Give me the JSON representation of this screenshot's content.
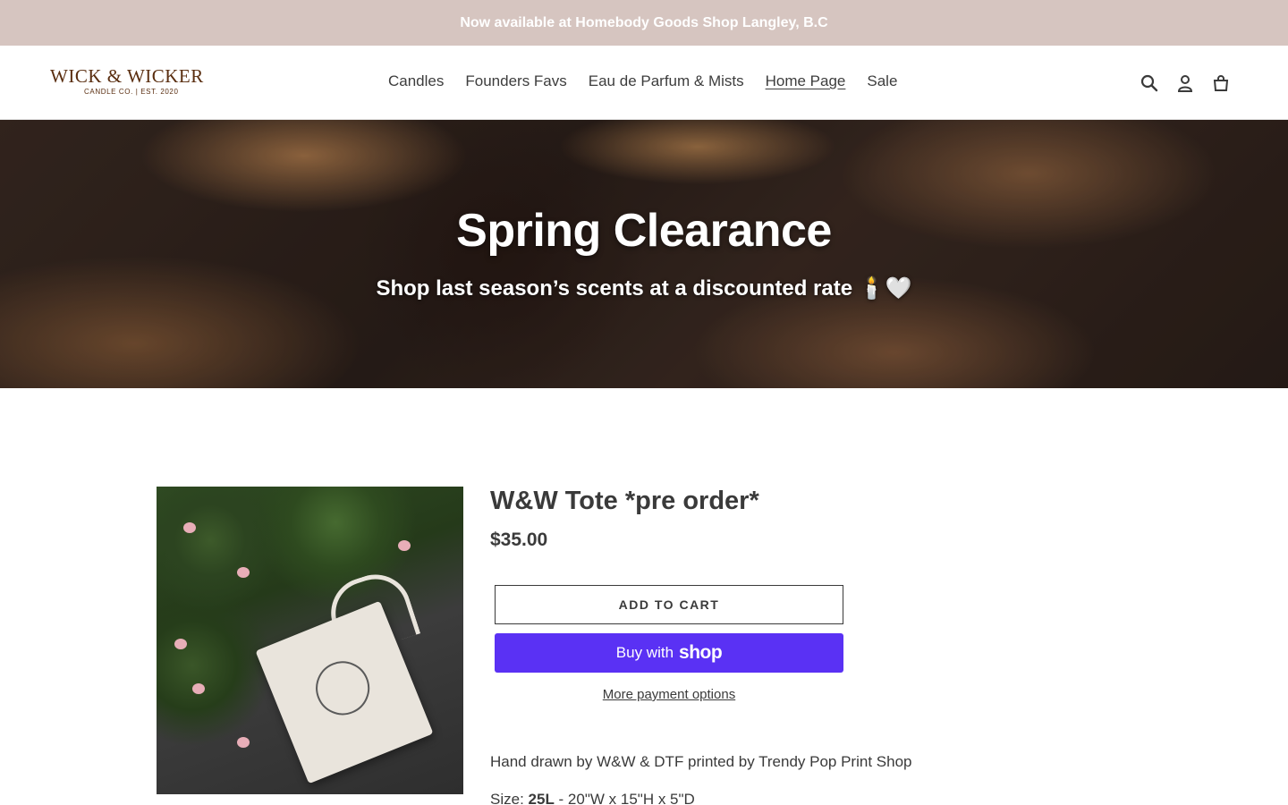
{
  "announcement": {
    "text": "Now available at Homebody Goods Shop Langley, B.C"
  },
  "header": {
    "logo": {
      "main": "WICK & WICKER",
      "sub": "CANDLE CO. | EST. 2020"
    },
    "nav": [
      {
        "label": "Candles"
      },
      {
        "label": "Founders Favs"
      },
      {
        "label": "Eau de Parfum & Mists"
      },
      {
        "label": "Home Page"
      },
      {
        "label": "Sale"
      }
    ],
    "icons": [
      "search-icon",
      "account-icon",
      "cart-icon"
    ]
  },
  "hero": {
    "title": "Spring Clearance",
    "subtitle": "Shop last season’s scents at a discounted rate 🕯️🤍"
  },
  "product": {
    "title": "W&W Tote *pre order*",
    "price": "$35.00",
    "add_to_cart": "ADD TO CART",
    "buy_with": "Buy with",
    "shop_logo": "shop",
    "more_payment": "More payment options",
    "description": "Hand drawn by W&W & DTF printed by Trendy Pop Print Shop",
    "size_label": "Size: ",
    "size_value": "25L",
    "size_dims": " - 20\"W x 15\"H x 5\"D"
  },
  "colors": {
    "announcement_bg": "#d6c5c0",
    "shop_pay": "#5a31f4",
    "text": "#3a3a3a",
    "logo": "#5a2e10"
  }
}
